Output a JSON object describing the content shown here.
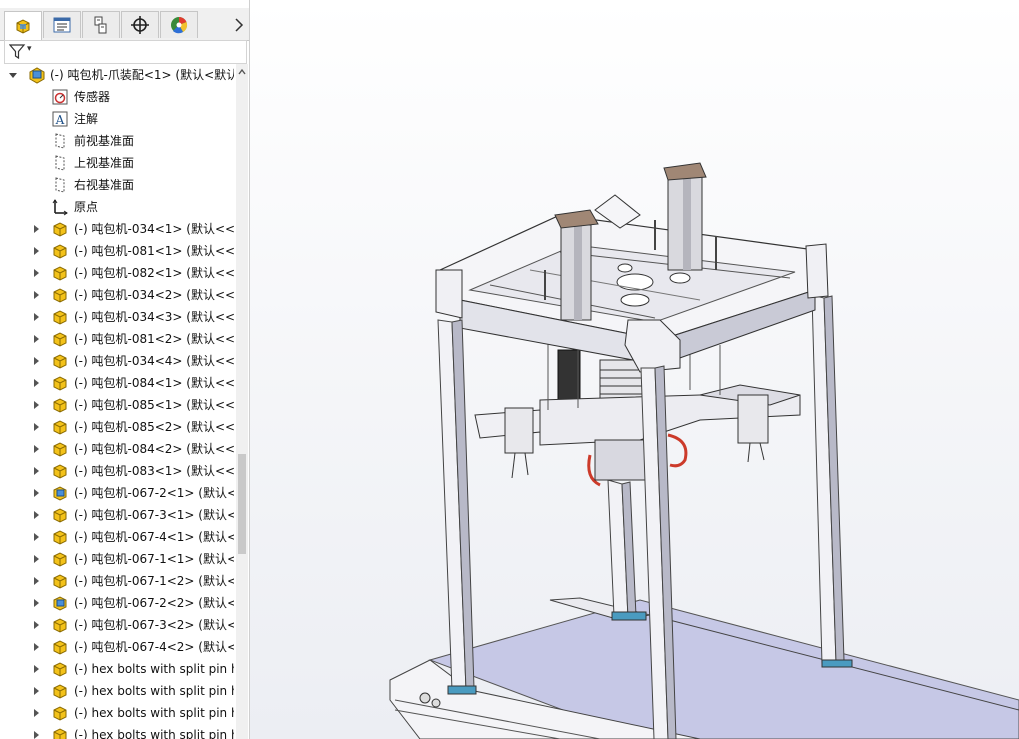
{
  "feature_manager": {
    "tabs": [
      {
        "name": "featuremanager-tree-icon"
      },
      {
        "name": "property-manager-icon"
      },
      {
        "name": "configuration-manager-icon"
      },
      {
        "name": "dimxpert-icon"
      },
      {
        "name": "display-manager-icon"
      }
    ],
    "more_tabs_glyph": "›",
    "filter_glyph": "▾",
    "root": {
      "label": "(-) 吨包机-爪装配<1> (默认<默认"
    },
    "system_items": [
      {
        "label": "传感器",
        "icon": "sensor-icon"
      },
      {
        "label": "注解",
        "icon": "annotation-icon"
      },
      {
        "label": "前视基准面",
        "icon": "plane-icon"
      },
      {
        "label": "上视基准面",
        "icon": "plane-icon"
      },
      {
        "label": "右视基准面",
        "icon": "plane-icon"
      },
      {
        "label": "原点",
        "icon": "origin-icon"
      }
    ],
    "components": [
      {
        "label": "(-) 吨包机-034<1> (默认<<默",
        "icon": "part-icon"
      },
      {
        "label": "(-) 吨包机-081<1> (默认<<默",
        "icon": "part-icon"
      },
      {
        "label": "(-) 吨包机-082<1> (默认<<默",
        "icon": "part-icon"
      },
      {
        "label": "(-) 吨包机-034<2> (默认<<默",
        "icon": "part-icon"
      },
      {
        "label": "(-) 吨包机-034<3> (默认<<默",
        "icon": "part-icon"
      },
      {
        "label": "(-) 吨包机-081<2> (默认<<默",
        "icon": "part-icon"
      },
      {
        "label": "(-) 吨包机-034<4> (默认<<默",
        "icon": "part-icon"
      },
      {
        "label": "(-) 吨包机-084<1> (默认<<默",
        "icon": "part-icon"
      },
      {
        "label": "(-) 吨包机-085<1> (默认<<默",
        "icon": "part-icon"
      },
      {
        "label": "(-) 吨包机-085<2> (默认<<默",
        "icon": "part-icon"
      },
      {
        "label": "(-) 吨包机-084<2> (默认<<默",
        "icon": "part-icon"
      },
      {
        "label": "(-) 吨包机-083<1> (默认<<默",
        "icon": "part-icon"
      },
      {
        "label": "(-) 吨包机-067-2<1> (默认<默",
        "icon": "subassembly-icon"
      },
      {
        "label": "(-) 吨包机-067-3<1> (默认<",
        "icon": "part-icon"
      },
      {
        "label": "(-) 吨包机-067-4<1> (默认<",
        "icon": "part-icon"
      },
      {
        "label": "(-) 吨包机-067-1<1> (默认<",
        "icon": "part-icon"
      },
      {
        "label": "(-) 吨包机-067-1<2> (默认<",
        "icon": "part-icon"
      },
      {
        "label": "(-) 吨包机-067-2<2> (默认<默",
        "icon": "subassembly-icon"
      },
      {
        "label": "(-) 吨包机-067-3<2> (默认<",
        "icon": "part-icon"
      },
      {
        "label": "(-) 吨包机-067-4<2> (默认<",
        "icon": "part-icon"
      },
      {
        "label": "(-) hex bolts with split pin h",
        "icon": "part-icon"
      },
      {
        "label": "(-) hex bolts with split pin h",
        "icon": "part-icon"
      },
      {
        "label": "(-) hex bolts with split pin h",
        "icon": "part-icon"
      },
      {
        "label": "(-) hex bolts with split pin h",
        "icon": "part-icon"
      }
    ]
  },
  "colors": {
    "part_yellow": "#f3c21a",
    "subassembly_blue": "#4a90d9",
    "frame_white": "#f2f2f6",
    "frame_shadow": "#b8b9c8",
    "belt_lavender": "#c6c8e6",
    "accent_red": "#cc3a2a"
  }
}
